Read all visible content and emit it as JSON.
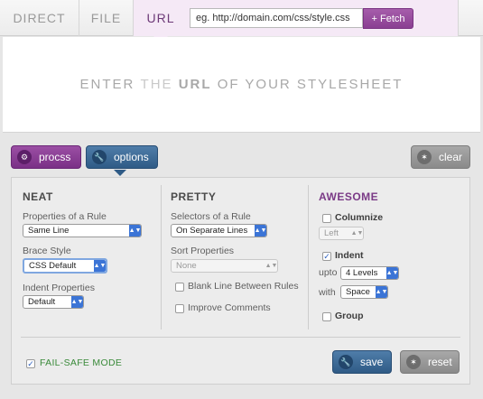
{
  "tabs": {
    "direct": "DIRECT",
    "file": "FILE",
    "url": "URL"
  },
  "url_input": {
    "placeholder": "eg. http://domain.com/css/style.css",
    "value": ""
  },
  "fetch_button": "+ Fetch",
  "hero": {
    "part1": "ENTER",
    "part2": "THE",
    "part3": "URL",
    "part4": "OF YOUR STYLESHEET"
  },
  "toolbar": {
    "procss": "procss",
    "options": "options",
    "clear": "clear"
  },
  "neat": {
    "title": "NEAT",
    "props_label": "Properties of a Rule",
    "props_value": "Same Line",
    "brace_label": "Brace Style",
    "brace_value": "CSS Default",
    "indent_label": "Indent Properties",
    "indent_value": "Default"
  },
  "pretty": {
    "title": "PRETTY",
    "selectors_label": "Selectors of a Rule",
    "selectors_value": "On Separate Lines",
    "sort_label": "Sort Properties",
    "sort_value": "None",
    "blank_line_label": "Blank Line Between Rules",
    "blank_line_checked": false,
    "improve_label": "Improve Comments",
    "improve_checked": false
  },
  "awesome": {
    "title": "AWESOME",
    "columnize_label": "Columnize",
    "columnize_checked": false,
    "columnize_value": "Left",
    "indent_label": "Indent",
    "indent_checked": true,
    "upto_label": "upto",
    "upto_value": "4 Levels",
    "with_label": "with",
    "with_value": "Space",
    "group_label": "Group",
    "group_checked": false
  },
  "footer": {
    "failsafe_label": "FAIL-SAFE MODE",
    "failsafe_checked": true,
    "save": "save",
    "reset": "reset"
  },
  "colors": {
    "purple": "#8a3f92",
    "blue": "#2f5b86",
    "gray": "#8a8a8a",
    "green_label": "#3a8a3a"
  }
}
